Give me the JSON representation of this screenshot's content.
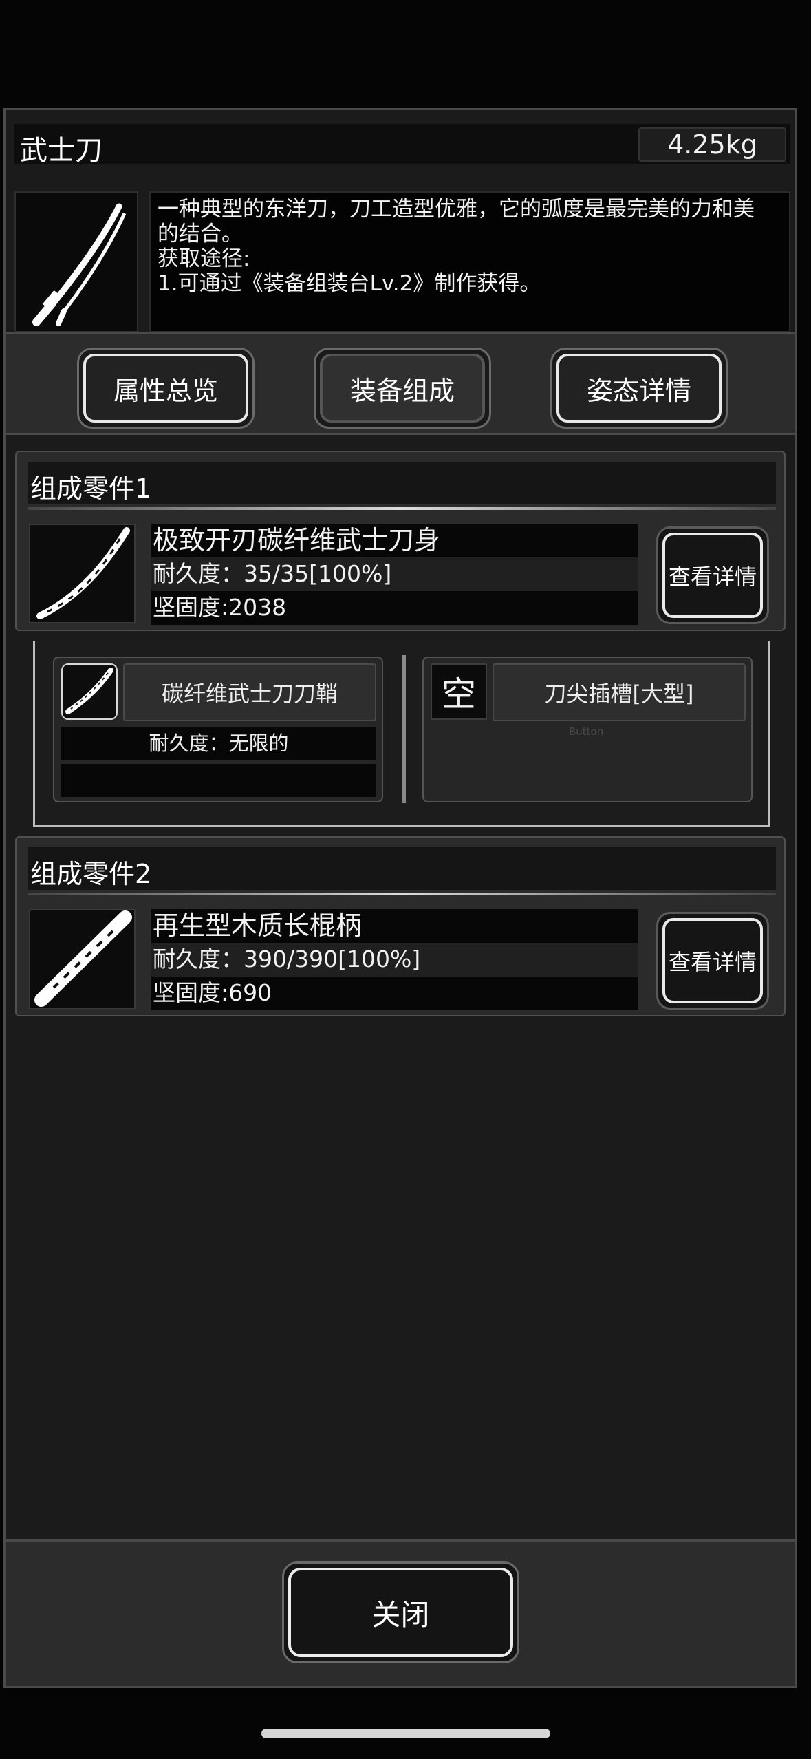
{
  "item": {
    "name": "武士刀",
    "weight": "4.25kg",
    "description_lines": [
      "一种典型的东洋刀，刀工造型优雅，它的弧度是最完美的力和美",
      "的结合。",
      "获取途径:",
      "1.可通过《装备组装台Lv.2》制作获得。"
    ],
    "icon": "katana-icon"
  },
  "tabs": [
    {
      "label": "属性总览",
      "active": false
    },
    {
      "label": "装备组成",
      "active": true
    },
    {
      "label": "姿态详情",
      "active": false
    }
  ],
  "components": [
    {
      "header": "组成零件1",
      "name": "极致开刃碳纤维武士刀身",
      "durability": "耐久度：35/35[100%]",
      "hardness": "坚固度:2038",
      "button": "查看详情",
      "icon": "blade-icon"
    },
    {
      "header": "组成零件2",
      "name": "再生型木质长棍柄",
      "durability": "耐久度：390/390[100%]",
      "hardness": "坚固度:690",
      "button": "查看详情",
      "icon": "handle-icon"
    }
  ],
  "slots": {
    "left": {
      "name": "碳纤维武士刀刀鞘",
      "durability": "耐久度：无限的",
      "icon": "scabbard-icon"
    },
    "right": {
      "empty_char": "空",
      "name": "刀尖插槽[大型]",
      "hint": "Button"
    }
  },
  "close_label": "关闭"
}
